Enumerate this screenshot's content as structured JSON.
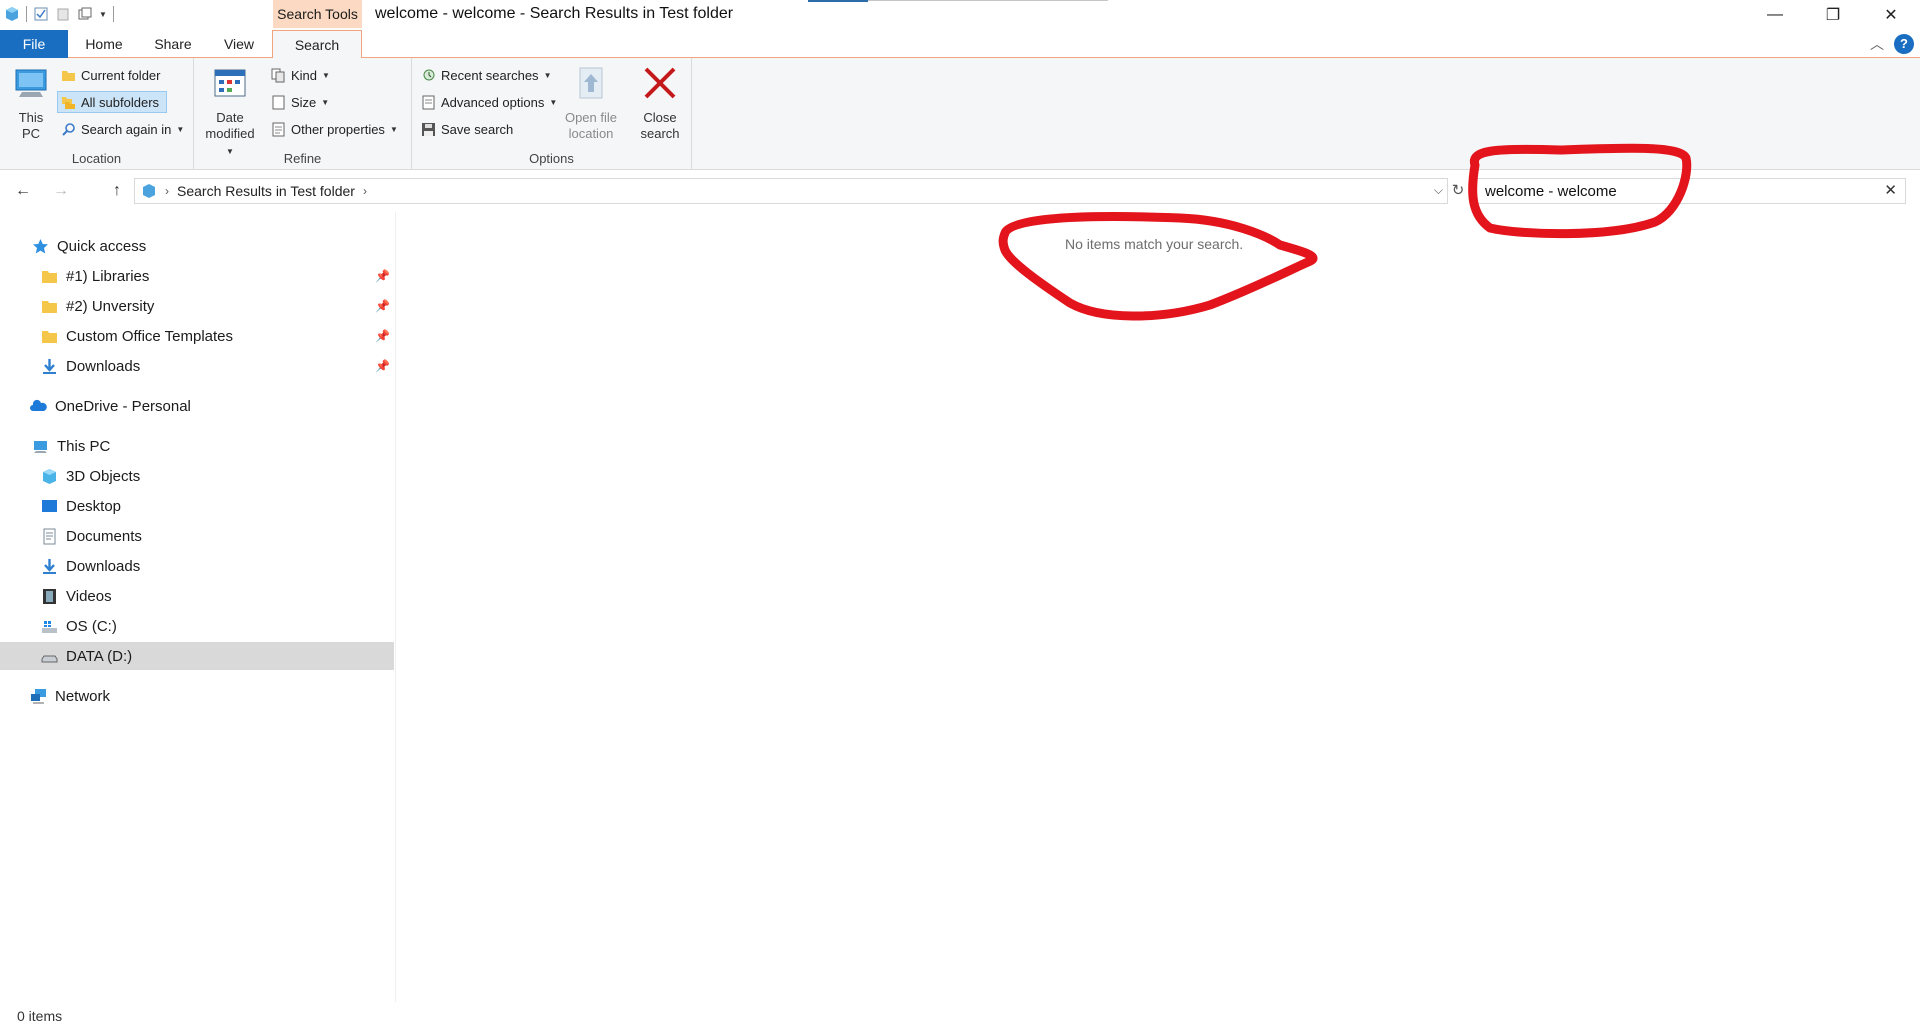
{
  "window": {
    "title": "welcome - welcome - Search Results in Test folder",
    "context_tab": "Search Tools",
    "controls": {
      "minimize": "—",
      "maximize": "❐",
      "close": "✕"
    }
  },
  "ribbon_tabs": {
    "file": "File",
    "home": "Home",
    "share": "Share",
    "view": "View",
    "search": "Search"
  },
  "ribbon": {
    "location": {
      "label": "Location",
      "this_pc": "This PC",
      "this_pc_line1": "This",
      "this_pc_line2": "PC",
      "current_folder": "Current folder",
      "all_subfolders": "All subfolders",
      "search_again_in": "Search again in"
    },
    "refine": {
      "label": "Refine",
      "date_modified_line1": "Date",
      "date_modified_line2": "modified",
      "kind": "Kind",
      "size": "Size",
      "other_properties": "Other properties"
    },
    "options": {
      "label": "Options",
      "recent_searches": "Recent searches",
      "advanced_options": "Advanced options",
      "save_search": "Save search",
      "open_file_location_line1": "Open file",
      "open_file_location_line2": "location",
      "close_search_line1": "Close",
      "close_search_line2": "search"
    }
  },
  "address": {
    "crumb": "Search Results in Test folder",
    "search_value": "welcome - welcome"
  },
  "nav": {
    "quick_access": "Quick access",
    "pinned": [
      {
        "label": "#1) Libraries"
      },
      {
        "label": "#2) Unversity"
      },
      {
        "label": "Custom Office Templates"
      },
      {
        "label": "Downloads"
      }
    ],
    "onedrive": "OneDrive - Personal",
    "this_pc": "This PC",
    "pc_items": [
      {
        "label": "3D Objects"
      },
      {
        "label": "Desktop"
      },
      {
        "label": "Documents"
      },
      {
        "label": "Downloads"
      },
      {
        "label": "Videos"
      },
      {
        "label": "OS (C:)"
      },
      {
        "label": "DATA (D:)"
      }
    ],
    "network": "Network"
  },
  "content": {
    "empty_message": "No items match your search."
  },
  "status": {
    "count": "0 items"
  },
  "colors": {
    "accent": "#1a6ec1",
    "annotation": "#e3141b",
    "context_tab": "#fbd9c2"
  }
}
